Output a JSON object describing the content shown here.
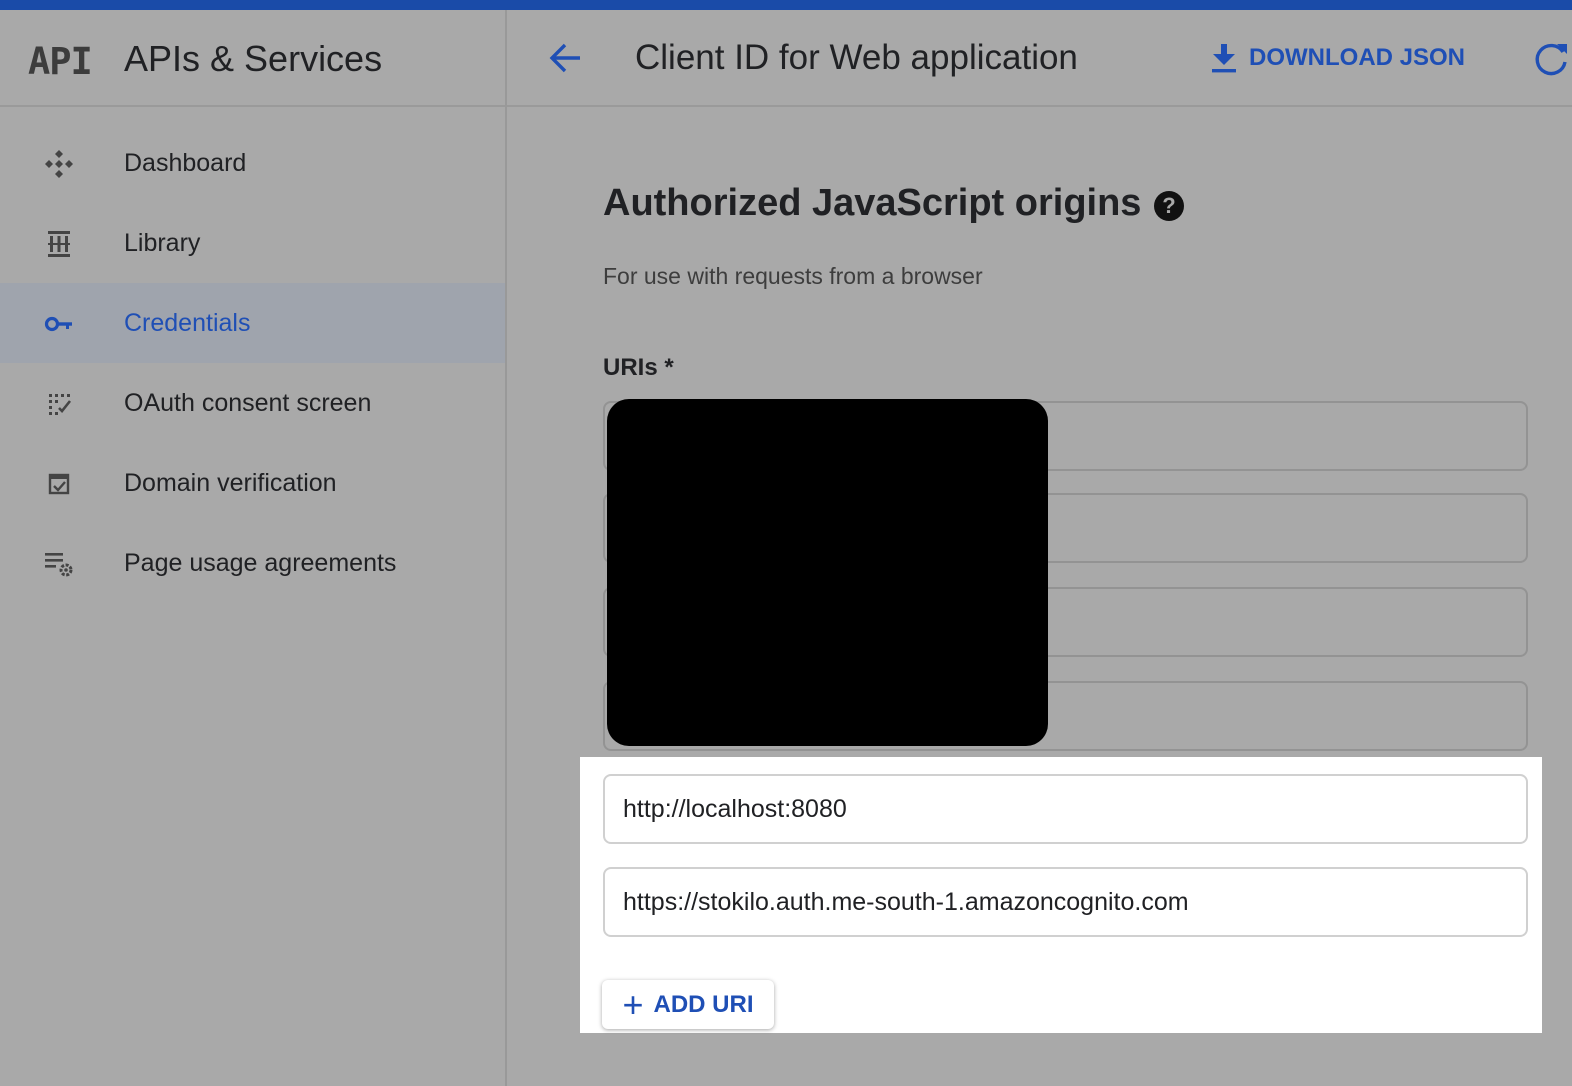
{
  "sidebar": {
    "logo": "API",
    "title": "APIs & Services",
    "items": [
      {
        "label": "Dashboard",
        "icon": "dashboard-icon"
      },
      {
        "label": "Library",
        "icon": "library-icon"
      },
      {
        "label": "Credentials",
        "icon": "key-icon",
        "active": true
      },
      {
        "label": "OAuth consent screen",
        "icon": "consent-icon"
      },
      {
        "label": "Domain verification",
        "icon": "checkbox-icon"
      },
      {
        "label": "Page usage agreements",
        "icon": "settings-list-icon"
      }
    ]
  },
  "header": {
    "title": "Client ID for Web application",
    "download_label": "DOWNLOAD JSON"
  },
  "section": {
    "title": "Authorized JavaScript origins",
    "help": "?",
    "description": "For use with requests from a browser",
    "uris_label": "URIs *",
    "uri_values": [
      "http://localhost:8080",
      "https://stokilo.auth.me-south-1.amazoncognito.com"
    ],
    "add_label": "ADD URI"
  },
  "colors": {
    "accent": "#1f4fb5",
    "topbar": "#1a4ba8",
    "active_bg": "#9fa4ad"
  }
}
